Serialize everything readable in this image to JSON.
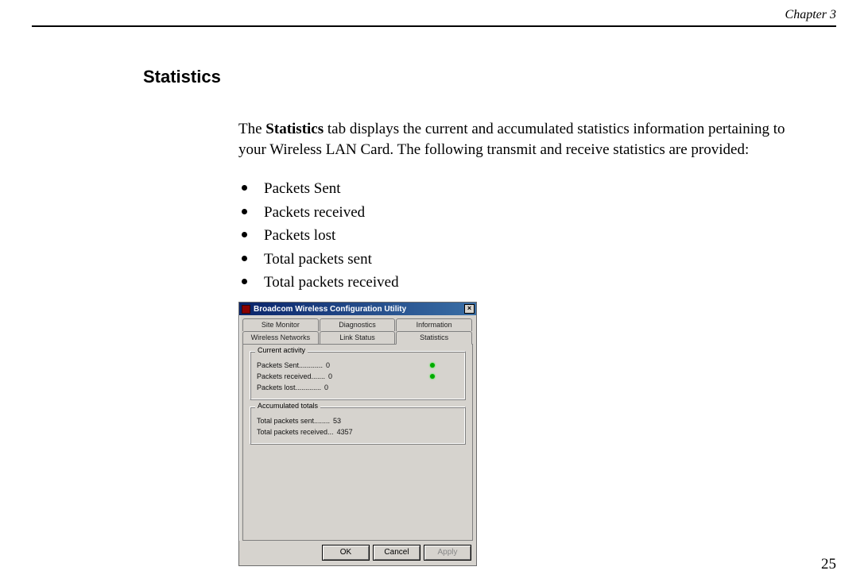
{
  "header": {
    "chapter_label": "Chapter 3"
  },
  "section": {
    "heading": "Statistics",
    "para_pre": "The ",
    "para_bold": "Statistics",
    "para_post": " tab displays the current and accumulated statistics information pertaining to your Wireless LAN Card. The following transmit and receive statistics are provided:",
    "bullets": [
      "Packets Sent",
      "Packets received",
      "Packets lost",
      "Total packets sent",
      "Total packets received"
    ]
  },
  "dialog": {
    "title": "Broadcom Wireless Configuration Utility",
    "close_glyph": "×",
    "tabs_row1": [
      "Site Monitor",
      "Diagnostics",
      "Information"
    ],
    "tabs_row2": [
      "Wireless Networks",
      "Link Status",
      "Statistics"
    ],
    "active_tab": "Statistics",
    "group_current": {
      "legend": "Current activity",
      "rows": [
        {
          "label": "Packets Sent............",
          "value": "0",
          "led": true
        },
        {
          "label": "Packets received.......",
          "value": "0",
          "led": true
        },
        {
          "label": "Packets lost.............",
          "value": "0",
          "led": false
        }
      ]
    },
    "group_totals": {
      "legend": "Accumulated totals",
      "rows": [
        {
          "label": "Total packets sent........",
          "value": "53"
        },
        {
          "label": "Total packets received...",
          "value": "4357"
        }
      ]
    },
    "buttons": {
      "ok": "OK",
      "cancel": "Cancel",
      "apply": "Apply"
    }
  },
  "page_number": "25"
}
